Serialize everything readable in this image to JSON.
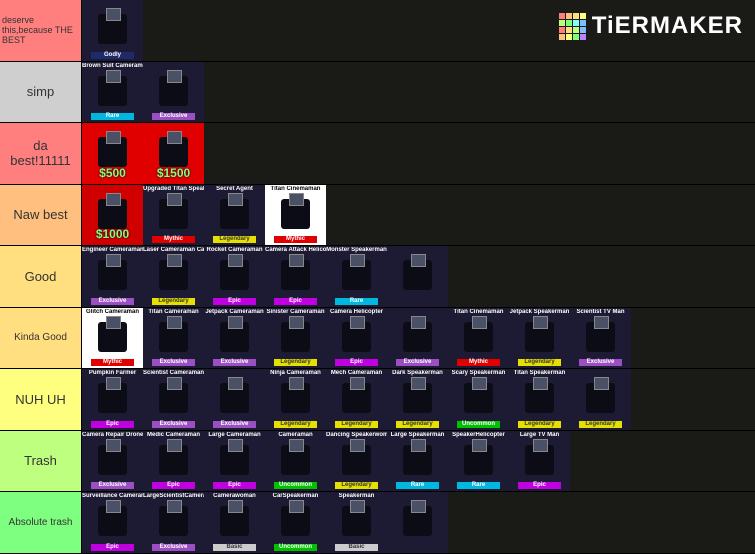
{
  "logo": {
    "text": "TiERMAKER",
    "colors": [
      "#ff7f7f",
      "#ffbf7f",
      "#ffdf7f",
      "#ffff7f",
      "#bfff7f",
      "#7fff7f",
      "#7fffff",
      "#7fbfff",
      "#ff7f7f",
      "#ffdf7f",
      "#bfff7f",
      "#7fbfff",
      "#ffbf7f",
      "#ffff7f",
      "#7fff7f",
      "#bf7fff"
    ]
  },
  "rarity_colors": {
    "Godly": "#1f2a6b",
    "Rare": "#00b7e0",
    "Mythic": "#e00000",
    "Legendary": "#e5e000",
    "Exclusive": "#9b4fc2",
    "Epic": "#c000e0",
    "Uncommon": "#00c000",
    "Basic": "#cccccc"
  },
  "tiers": [
    {
      "label": "deserve this,because THE BEST",
      "color": "#ff7f7f",
      "items": [
        {
          "name": "",
          "rarity": "Godly"
        }
      ]
    },
    {
      "label": "simp",
      "color": "#cfcfcf",
      "items": [
        {
          "name": "Brown Suit Cameraman",
          "rarity": "Rare"
        },
        {
          "name": "",
          "rarity": "Exclusive"
        }
      ]
    },
    {
      "label": "da best!11111",
      "color": "#ff7f7f",
      "items": [
        {
          "name": "",
          "price": "$500",
          "bg": "#e00000"
        },
        {
          "name": "",
          "price": "$1500",
          "bg": "#e00000"
        }
      ]
    },
    {
      "label": "Naw best",
      "color": "#ffbf7f",
      "items": [
        {
          "name": "",
          "price": "$1000",
          "bg": "#d00000"
        },
        {
          "name": "Upgraded Titan Speakerman",
          "rarity": "Mythic"
        },
        {
          "name": "Secret Agent",
          "rarity": "Legendary"
        },
        {
          "name": "Titan Cinemaman",
          "rarity": "Mythic",
          "bg": "#ffffff"
        }
      ]
    },
    {
      "label": "Good",
      "color": "#ffdf7f",
      "items": [
        {
          "name": "Engineer Cameraman",
          "rarity": "Exclusive"
        },
        {
          "name": "Laser Cameraman Car",
          "rarity": "Legendary"
        },
        {
          "name": "Rocket Cameraman",
          "rarity": "Epic"
        },
        {
          "name": "Camera Attack Helicopter",
          "rarity": "Epic"
        },
        {
          "name": "Monster Speakerman",
          "rarity": "Rare"
        },
        {
          "name": ""
        }
      ]
    },
    {
      "label": "Kinda Good",
      "color": "#ffdf7f",
      "items": [
        {
          "name": "Glitch Cameraman",
          "rarity": "Mythic",
          "bg": "#ffffff"
        },
        {
          "name": "Titan Cameraman",
          "rarity": "Exclusive"
        },
        {
          "name": "Jetpack Cameraman",
          "rarity": "Exclusive"
        },
        {
          "name": "Sinister Cameraman",
          "rarity": "Legendary"
        },
        {
          "name": "Camera Helicopter",
          "rarity": "Epic"
        },
        {
          "name": "",
          "rarity": "Exclusive"
        },
        {
          "name": "Titan Cinemaman",
          "rarity": "Mythic"
        },
        {
          "name": "Jetpack Speakerman",
          "rarity": "Legendary"
        },
        {
          "name": "Scientist TV Man",
          "rarity": "Exclusive"
        }
      ]
    },
    {
      "label": "NUH UH",
      "color": "#ffff7f",
      "items": [
        {
          "name": "Pumpkin Farmer",
          "rarity": "Epic"
        },
        {
          "name": "Scientist Cameraman",
          "rarity": "Exclusive"
        },
        {
          "name": "",
          "rarity": "Exclusive"
        },
        {
          "name": "Ninja Cameraman",
          "rarity": "Legendary"
        },
        {
          "name": "Mech Cameraman",
          "rarity": "Legendary"
        },
        {
          "name": "Dark Speakerman",
          "rarity": "Legendary"
        },
        {
          "name": "Scary Speakerman",
          "rarity": "Uncommon"
        },
        {
          "name": "Titan Speakerman",
          "rarity": "Legendary"
        },
        {
          "name": "",
          "rarity": "Legendary"
        }
      ]
    },
    {
      "label": "Trash",
      "color": "#bfff7f",
      "items": [
        {
          "name": "Camera Repair Drone",
          "rarity": "Exclusive"
        },
        {
          "name": "Medic Cameraman",
          "rarity": "Epic"
        },
        {
          "name": "Large Cameraman",
          "rarity": "Epic"
        },
        {
          "name": "Cameraman",
          "rarity": "Uncommon"
        },
        {
          "name": "Dancing Speakerwoman",
          "rarity": "Legendary"
        },
        {
          "name": "Large Speakerman",
          "rarity": "Rare"
        },
        {
          "name": "SpeakerHelicopter",
          "rarity": "Rare"
        },
        {
          "name": "Large TV Man",
          "rarity": "Epic"
        }
      ]
    },
    {
      "label": "Absolute trash",
      "color": "#7fff7f",
      "items": [
        {
          "name": "Surveillance Cameraman",
          "rarity": "Epic"
        },
        {
          "name": "LargeScientistCameraman",
          "rarity": "Exclusive"
        },
        {
          "name": "Camerawoman",
          "rarity": "Basic"
        },
        {
          "name": "CarSpeakerman",
          "rarity": "Uncommon"
        },
        {
          "name": "Speakerman",
          "rarity": "Basic"
        },
        {
          "name": ""
        }
      ]
    }
  ]
}
